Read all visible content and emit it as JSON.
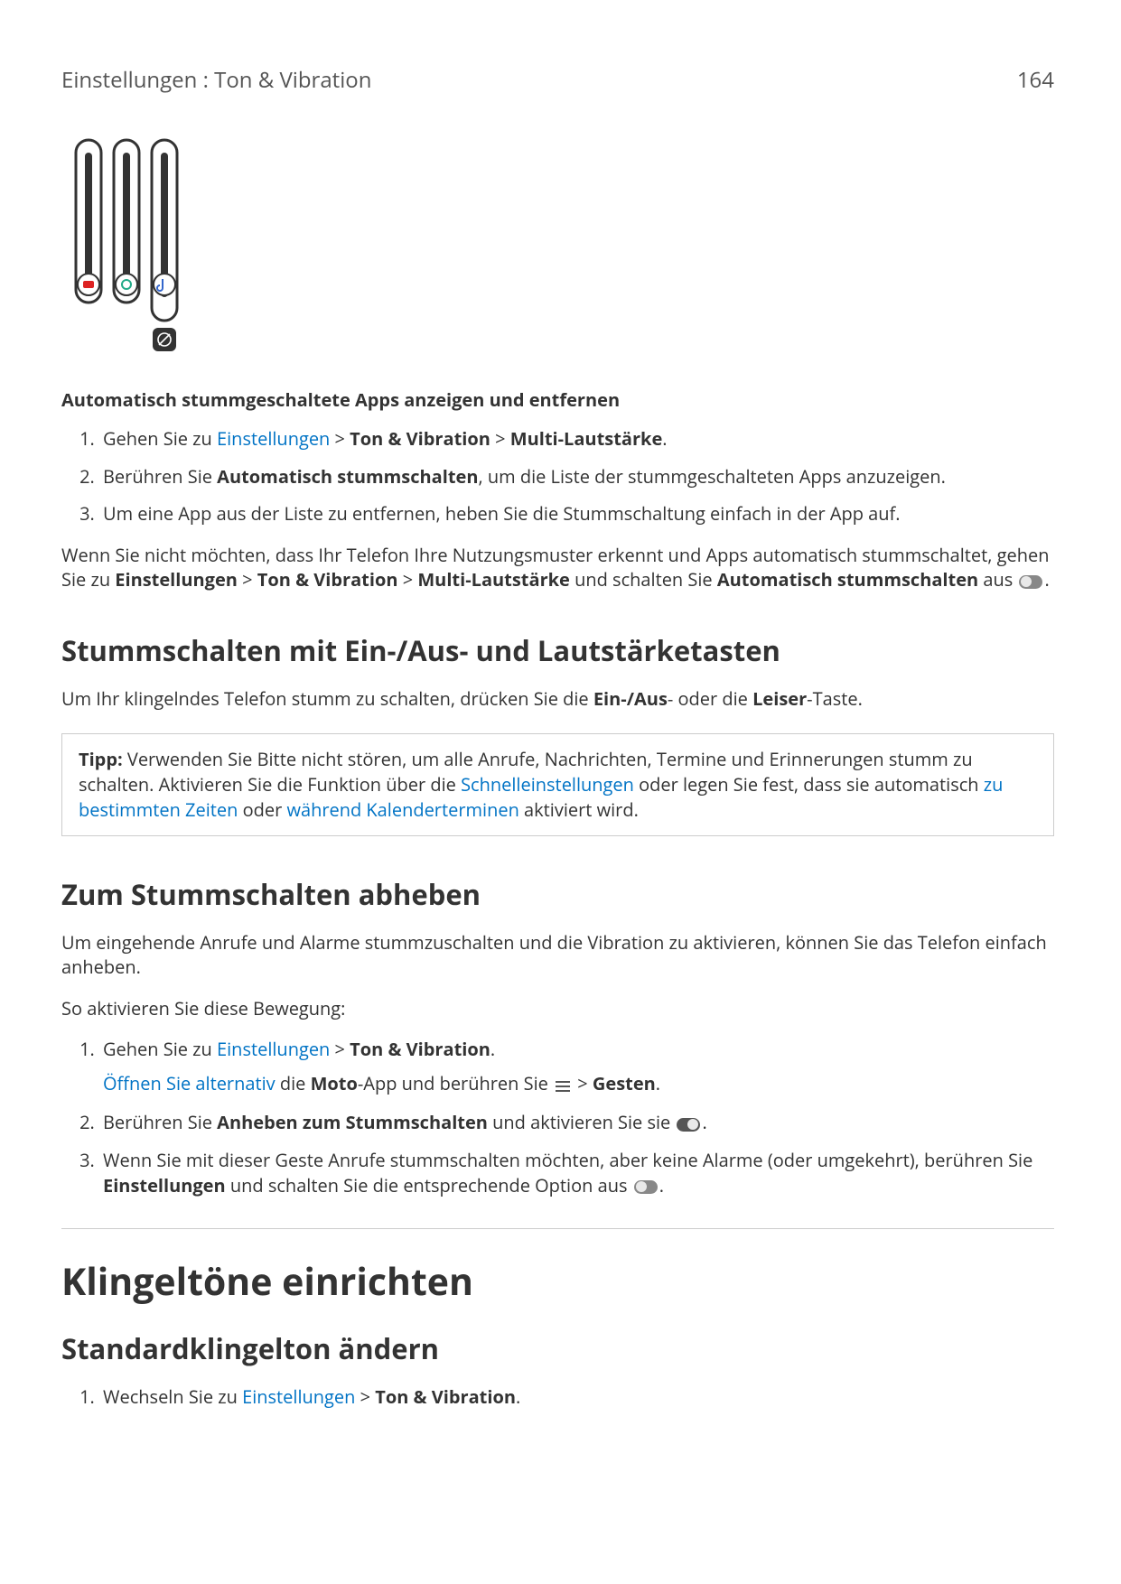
{
  "header": {
    "breadcrumb": "Einstellungen : Ton & Vibration",
    "page_number": "164"
  },
  "sectionA": {
    "subheading": "Automatisch stummgeschaltete Apps anzeigen und entfernen",
    "steps": {
      "s1": {
        "pre": "Gehen Sie zu ",
        "link": "Einstellungen",
        "post": " > ",
        "b1": "Ton & Vibration",
        "mid": " > ",
        "b2": "Multi-Lautstärke",
        "end": "."
      },
      "s2": {
        "pre": "Berühren Sie ",
        "b1": "Automatisch stummschalten",
        "post": ", um die Liste der stummgeschalteten Apps anzuzeigen."
      },
      "s3": "Um eine App aus der Liste zu entfernen, heben Sie die Stummschaltung einfach in der App auf."
    },
    "para": {
      "pre": "Wenn Sie nicht möchten, dass Ihr Telefon Ihre Nutzungsmuster erkennt und Apps automatisch stummschaltet, gehen Sie zu ",
      "b1": "Einstellungen",
      "mid1": " > ",
      "b2": "Ton & Vibration",
      "mid2": " > ",
      "b3": "Multi-Lautstärke",
      "mid3": " und schalten Sie ",
      "b4": "Automatisch stummschalten",
      "mid4": " aus ",
      "end": "."
    }
  },
  "sectionB": {
    "heading": "Stummschalten mit Ein-/Aus- und Lautstärketasten",
    "para": {
      "pre": "Um Ihr klingelndes Telefon stumm zu schalten, drücken Sie die ",
      "b1": "Ein-/Aus",
      "mid": "- oder die ",
      "b2": "Leiser",
      "end": "-Taste."
    },
    "tip": {
      "label": "Tipp:",
      "pre": " Verwenden Sie Bitte nicht stören, um alle Anrufe, Nachrichten, Termine und Erinnerungen stumm zu schalten. Aktivieren Sie die Funktion über die ",
      "link1": "Schnelleinstellungen",
      "mid1": " oder legen Sie fest, dass sie automatisch ",
      "link2": "zu bestimmten Zeiten",
      "mid2": " oder ",
      "link3": "während Kalenderterminen",
      "end": " aktiviert wird."
    }
  },
  "sectionC": {
    "heading": "Zum Stummschalten abheben",
    "para1": "Um eingehende Anrufe und Alarme stummzuschalten und die Vibration zu aktivieren, können Sie das Telefon einfach anheben.",
    "para2": "So aktivieren Sie diese Bewegung:",
    "steps": {
      "s1": {
        "pre": "Gehen Sie zu ",
        "link": "Einstellungen",
        "mid": " > ",
        "b1": "Ton & Vibration",
        "end": ".",
        "sub_link": "Öffnen Sie alternativ",
        "sub_mid1": " die ",
        "sub_b1": "Moto",
        "sub_mid2": "-App und berühren Sie ",
        "sub_mid3": " > ",
        "sub_b2": "Gesten",
        "sub_end": "."
      },
      "s2": {
        "pre": "Berühren Sie ",
        "b1": "Anheben zum Stummschalten",
        "mid": " und aktivieren Sie sie ",
        "end": "."
      },
      "s3": {
        "pre": "Wenn Sie mit dieser Geste Anrufe stummschalten möchten, aber keine Alarme (oder umgekehrt), berühren Sie ",
        "b1": "Einstellungen",
        "mid": " und schalten Sie die entsprechende Option aus ",
        "end": "."
      }
    }
  },
  "sectionD": {
    "main_heading": "Klingeltöne einrichten",
    "sub_heading": "Standardklingelton ändern",
    "steps": {
      "s1": {
        "pre": "Wechseln Sie zu ",
        "link": "Einstellungen",
        "mid": " > ",
        "b1": "Ton & Vibration",
        "end": "."
      }
    }
  }
}
